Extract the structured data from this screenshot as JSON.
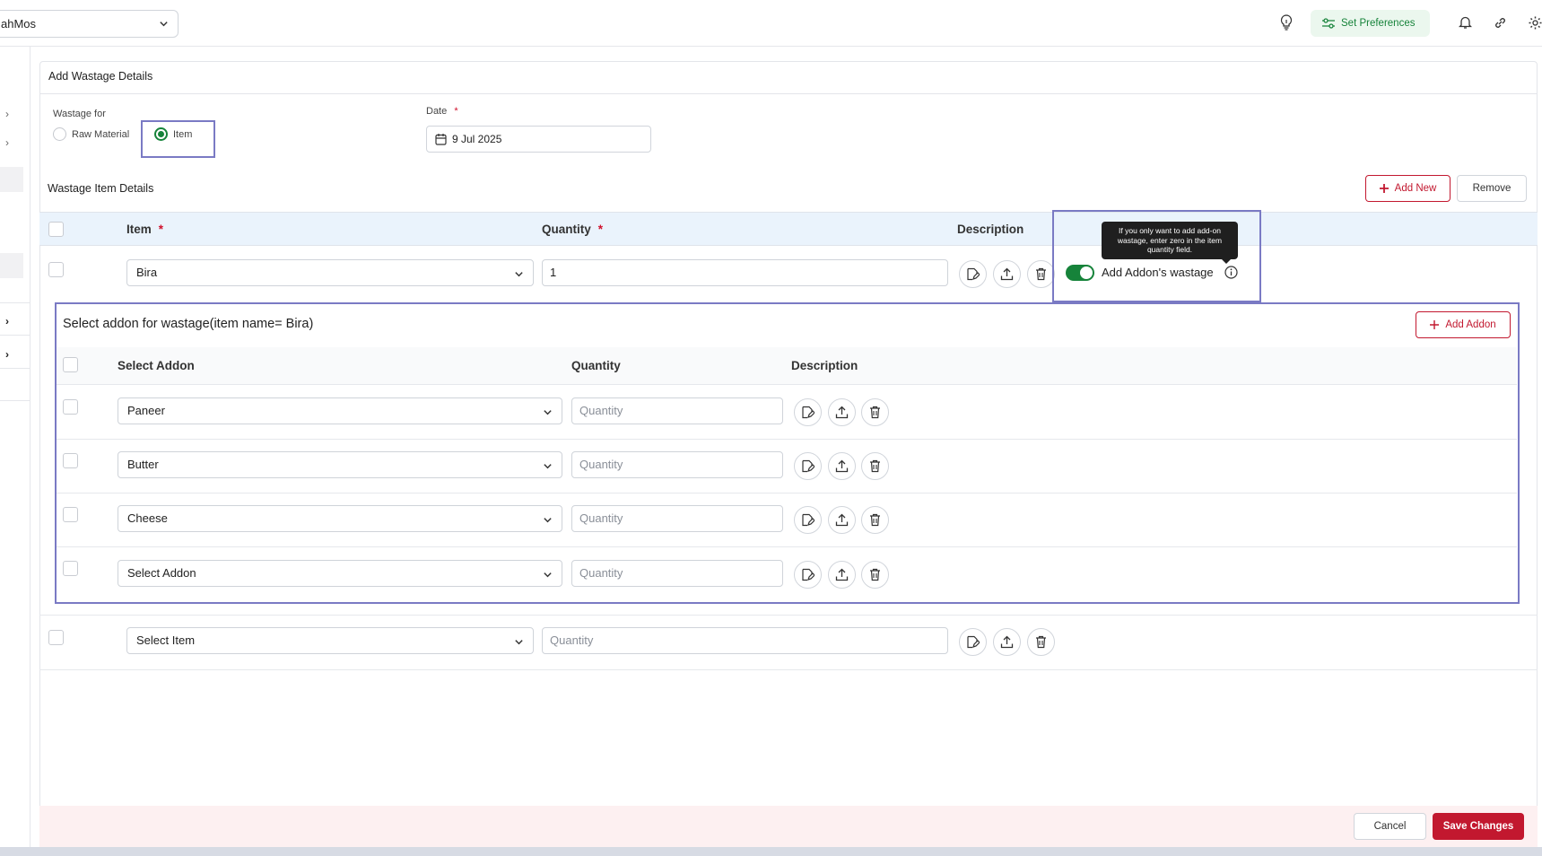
{
  "header": {
    "outlet_name": "ahMos",
    "set_preferences_label": "Set Preferences",
    "icons": [
      "lightbulb-icon",
      "preferences-icon",
      "bell-icon",
      "link-icon",
      "gear-icon"
    ]
  },
  "card": {
    "title": "Add Wastage Details",
    "wastage_for": {
      "label": "Wastage for",
      "options": [
        {
          "label": "Raw Material",
          "selected": false
        },
        {
          "label": "Item",
          "selected": true
        }
      ]
    },
    "date": {
      "label": "Date",
      "required_mark": "*",
      "value": "9 Jul 2025"
    }
  },
  "items_section": {
    "title": "Wastage Item Details",
    "add_new_label": "Add New",
    "remove_label": "Remove",
    "columns": {
      "item": "Item",
      "quantity": "Quantity",
      "description": "Description",
      "required_mark": "*"
    },
    "rows": [
      {
        "item": "Bira",
        "quantity": "1"
      },
      {
        "item": "Select Item",
        "quantity_placeholder": "Quantity"
      }
    ],
    "addon_toggle": {
      "label": "Add Addon's wastage",
      "enabled": true,
      "tooltip": "If you only want to add add-on wastage, enter zero in the item quantity field."
    }
  },
  "addon_panel": {
    "title": "Select addon for wastage(item name= Bira)",
    "add_addon_label": "Add Addon",
    "columns": {
      "select_addon": "Select Addon",
      "quantity": "Quantity",
      "description": "Description"
    },
    "rows": [
      {
        "addon": "Paneer",
        "quantity_placeholder": "Quantity"
      },
      {
        "addon": "Butter",
        "quantity_placeholder": "Quantity"
      },
      {
        "addon": "Cheese",
        "quantity_placeholder": "Quantity"
      },
      {
        "addon": "Select Addon",
        "quantity_placeholder": "Quantity"
      }
    ]
  },
  "footer": {
    "cancel_label": "Cancel",
    "save_label": "Save Changes"
  },
  "colors": {
    "brand_red": "#c2182f",
    "success_green": "#16833a",
    "highlight": "#7a7ac4"
  }
}
